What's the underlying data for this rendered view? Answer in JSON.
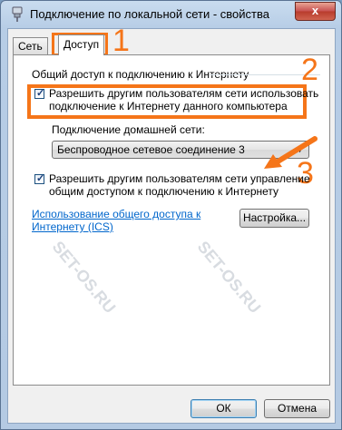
{
  "window": {
    "title": "Подключение по локальной сети - свойства",
    "close_glyph": "x"
  },
  "tabs": [
    {
      "label": "Сеть"
    },
    {
      "label": "Доступ"
    }
  ],
  "sharing": {
    "group_label": "Общий доступ к подключению к Интернету",
    "allow_sharing_line1": "Разрешить другим пользователям сети использовать",
    "allow_sharing_line2": "подключение к Интернету данного компьютера",
    "allow_sharing_checked": true,
    "home_network_label": "Подключение домашней сети:",
    "home_network_value": "Беспроводное сетевое соединение 3",
    "allow_control_line1": "Разрешить другим пользователям сети управление",
    "allow_control_line2": "общим доступом к подключению к Интернету",
    "allow_control_checked": true,
    "ics_link_line1": "Использование общего доступа к",
    "ics_link_line2": "Интернету (ICS)",
    "settings_button": "Настройка..."
  },
  "footer": {
    "ok_button": "ОК",
    "cancel_button": "Отмена"
  },
  "annotations": {
    "step1": "1",
    "step2": "2",
    "step3": "3",
    "accent_color": "#f57519"
  },
  "watermark": "SET-OS.RU"
}
